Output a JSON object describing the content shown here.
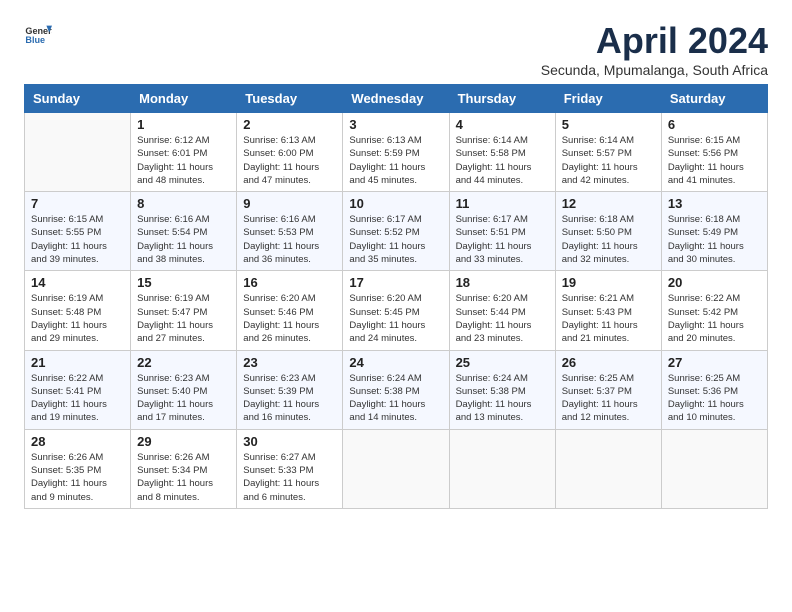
{
  "logo": {
    "general": "General",
    "blue": "Blue"
  },
  "title": "April 2024",
  "subtitle": "Secunda, Mpumalanga, South Africa",
  "days_of_week": [
    "Sunday",
    "Monday",
    "Tuesday",
    "Wednesday",
    "Thursday",
    "Friday",
    "Saturday"
  ],
  "weeks": [
    [
      {
        "day": "",
        "info": ""
      },
      {
        "day": "1",
        "info": "Sunrise: 6:12 AM\nSunset: 6:01 PM\nDaylight: 11 hours\nand 48 minutes."
      },
      {
        "day": "2",
        "info": "Sunrise: 6:13 AM\nSunset: 6:00 PM\nDaylight: 11 hours\nand 47 minutes."
      },
      {
        "day": "3",
        "info": "Sunrise: 6:13 AM\nSunset: 5:59 PM\nDaylight: 11 hours\nand 45 minutes."
      },
      {
        "day": "4",
        "info": "Sunrise: 6:14 AM\nSunset: 5:58 PM\nDaylight: 11 hours\nand 44 minutes."
      },
      {
        "day": "5",
        "info": "Sunrise: 6:14 AM\nSunset: 5:57 PM\nDaylight: 11 hours\nand 42 minutes."
      },
      {
        "day": "6",
        "info": "Sunrise: 6:15 AM\nSunset: 5:56 PM\nDaylight: 11 hours\nand 41 minutes."
      }
    ],
    [
      {
        "day": "7",
        "info": "Sunrise: 6:15 AM\nSunset: 5:55 PM\nDaylight: 11 hours\nand 39 minutes."
      },
      {
        "day": "8",
        "info": "Sunrise: 6:16 AM\nSunset: 5:54 PM\nDaylight: 11 hours\nand 38 minutes."
      },
      {
        "day": "9",
        "info": "Sunrise: 6:16 AM\nSunset: 5:53 PM\nDaylight: 11 hours\nand 36 minutes."
      },
      {
        "day": "10",
        "info": "Sunrise: 6:17 AM\nSunset: 5:52 PM\nDaylight: 11 hours\nand 35 minutes."
      },
      {
        "day": "11",
        "info": "Sunrise: 6:17 AM\nSunset: 5:51 PM\nDaylight: 11 hours\nand 33 minutes."
      },
      {
        "day": "12",
        "info": "Sunrise: 6:18 AM\nSunset: 5:50 PM\nDaylight: 11 hours\nand 32 minutes."
      },
      {
        "day": "13",
        "info": "Sunrise: 6:18 AM\nSunset: 5:49 PM\nDaylight: 11 hours\nand 30 minutes."
      }
    ],
    [
      {
        "day": "14",
        "info": "Sunrise: 6:19 AM\nSunset: 5:48 PM\nDaylight: 11 hours\nand 29 minutes."
      },
      {
        "day": "15",
        "info": "Sunrise: 6:19 AM\nSunset: 5:47 PM\nDaylight: 11 hours\nand 27 minutes."
      },
      {
        "day": "16",
        "info": "Sunrise: 6:20 AM\nSunset: 5:46 PM\nDaylight: 11 hours\nand 26 minutes."
      },
      {
        "day": "17",
        "info": "Sunrise: 6:20 AM\nSunset: 5:45 PM\nDaylight: 11 hours\nand 24 minutes."
      },
      {
        "day": "18",
        "info": "Sunrise: 6:20 AM\nSunset: 5:44 PM\nDaylight: 11 hours\nand 23 minutes."
      },
      {
        "day": "19",
        "info": "Sunrise: 6:21 AM\nSunset: 5:43 PM\nDaylight: 11 hours\nand 21 minutes."
      },
      {
        "day": "20",
        "info": "Sunrise: 6:22 AM\nSunset: 5:42 PM\nDaylight: 11 hours\nand 20 minutes."
      }
    ],
    [
      {
        "day": "21",
        "info": "Sunrise: 6:22 AM\nSunset: 5:41 PM\nDaylight: 11 hours\nand 19 minutes."
      },
      {
        "day": "22",
        "info": "Sunrise: 6:23 AM\nSunset: 5:40 PM\nDaylight: 11 hours\nand 17 minutes."
      },
      {
        "day": "23",
        "info": "Sunrise: 6:23 AM\nSunset: 5:39 PM\nDaylight: 11 hours\nand 16 minutes."
      },
      {
        "day": "24",
        "info": "Sunrise: 6:24 AM\nSunset: 5:38 PM\nDaylight: 11 hours\nand 14 minutes."
      },
      {
        "day": "25",
        "info": "Sunrise: 6:24 AM\nSunset: 5:38 PM\nDaylight: 11 hours\nand 13 minutes."
      },
      {
        "day": "26",
        "info": "Sunrise: 6:25 AM\nSunset: 5:37 PM\nDaylight: 11 hours\nand 12 minutes."
      },
      {
        "day": "27",
        "info": "Sunrise: 6:25 AM\nSunset: 5:36 PM\nDaylight: 11 hours\nand 10 minutes."
      }
    ],
    [
      {
        "day": "28",
        "info": "Sunrise: 6:26 AM\nSunset: 5:35 PM\nDaylight: 11 hours\nand 9 minutes."
      },
      {
        "day": "29",
        "info": "Sunrise: 6:26 AM\nSunset: 5:34 PM\nDaylight: 11 hours\nand 8 minutes."
      },
      {
        "day": "30",
        "info": "Sunrise: 6:27 AM\nSunset: 5:33 PM\nDaylight: 11 hours\nand 6 minutes."
      },
      {
        "day": "",
        "info": ""
      },
      {
        "day": "",
        "info": ""
      },
      {
        "day": "",
        "info": ""
      },
      {
        "day": "",
        "info": ""
      }
    ]
  ]
}
